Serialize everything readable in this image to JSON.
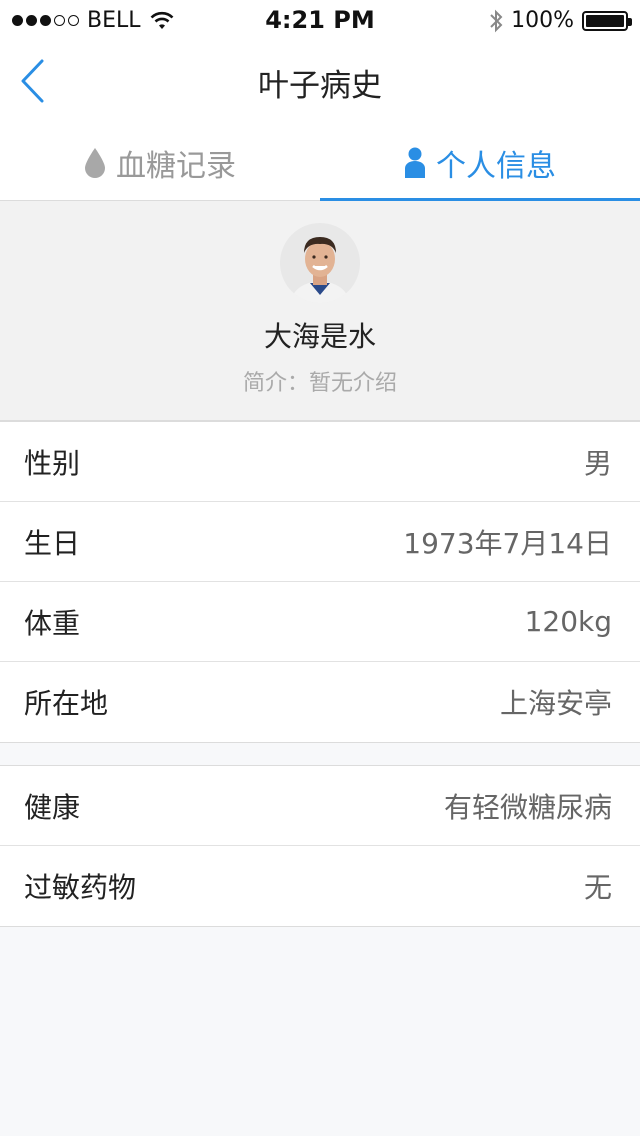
{
  "status_bar": {
    "carrier": "BELL",
    "time": "4:21 PM",
    "battery": "100%",
    "icons": [
      "signal-dots",
      "wifi-icon",
      "bluetooth-icon",
      "battery-icon"
    ]
  },
  "nav": {
    "back_icon": "chevron-left-icon",
    "title": "叶子病史"
  },
  "tabs": [
    {
      "label": "血糖记录",
      "icon": "blood-drop-icon",
      "active": false
    },
    {
      "label": "个人信息",
      "icon": "person-icon",
      "active": true
    }
  ],
  "profile": {
    "name": "大海是水",
    "intro": "简介：暂无介绍"
  },
  "groups": [
    {
      "rows": [
        {
          "label": "性别",
          "value": "男"
        },
        {
          "label": "生日",
          "value": "1973年7月14日"
        },
        {
          "label": "体重",
          "value": "120kg"
        },
        {
          "label": "所在地",
          "value": "上海安亭"
        }
      ]
    },
    {
      "rows": [
        {
          "label": "健康",
          "value": "有轻微糖尿病"
        },
        {
          "label": "过敏药物",
          "value": "无"
        }
      ]
    }
  ],
  "colors": {
    "accent": "#2a8ee4",
    "inactive_tab": "#999999",
    "profile_bg": "#f2f2f2",
    "page_bg": "#f7f8fa"
  }
}
